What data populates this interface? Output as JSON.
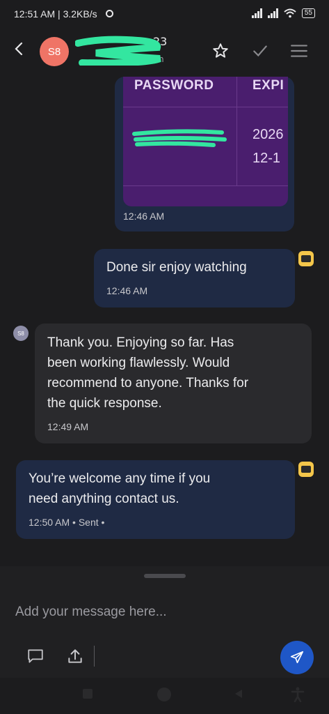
{
  "status": {
    "time_speed": "12:51 AM | 3.2KB/s",
    "battery": "55"
  },
  "header": {
    "avatar_initials": "S8",
    "contact_name_visible": "23",
    "contact_sub_visible": "n"
  },
  "card": {
    "col_password": "PASSWORD",
    "col_expiry": "EXPI",
    "expiry_line1": "2026",
    "expiry_line2": "12-1",
    "time": "12:46 AM"
  },
  "messages": [
    {
      "direction": "out",
      "text_lines": [
        "Done sir enjoy watching"
      ],
      "time": "12:46 AM"
    },
    {
      "direction": "in",
      "avatar": "S8",
      "text_lines": [
        "Thank you. Enjoying so far. Has",
        "been working flawlessly. Would",
        "recommend to anyone. Thanks for",
        "the quick response."
      ],
      "time": "12:49 AM"
    },
    {
      "direction": "out",
      "text_lines": [
        "You’re welcome any time if you",
        "need anything contact us."
      ],
      "time": "12:50 AM • Sent •"
    }
  ],
  "composer": {
    "placeholder": "Add your message here..."
  },
  "icons": {
    "back": "back-arrow-icon",
    "star": "star-icon",
    "check": "check-icon",
    "menu": "menu-icon",
    "chat": "chat-bubble-icon",
    "upload": "upload-icon",
    "send": "send-icon"
  },
  "colors": {
    "background": "#1c1c1e",
    "outgoing_bubble": "#1f2a44",
    "incoming_bubble": "#2a2a2d",
    "card_table": "#4a1e6e",
    "avatar": "#ef7466",
    "send_button": "#1f57c7",
    "redaction": "#33e6a0"
  }
}
